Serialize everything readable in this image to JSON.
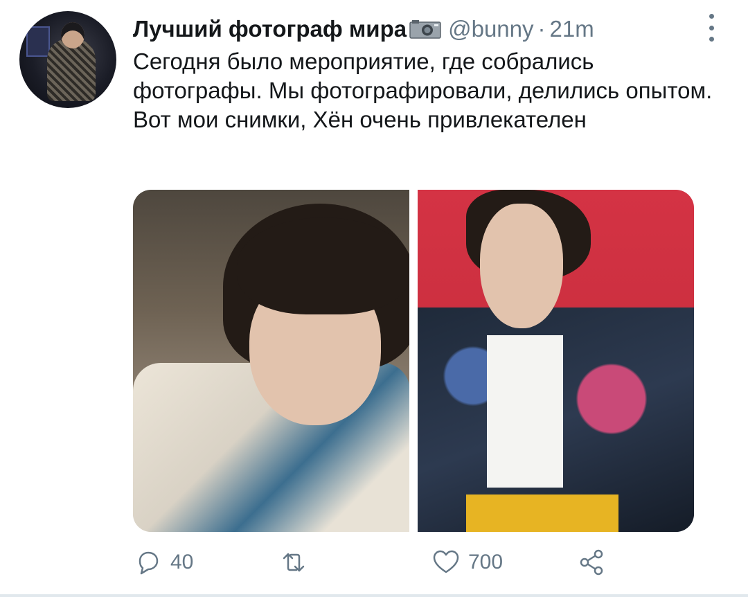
{
  "tweet": {
    "display_name": "Лучший фотограф мира",
    "handle": "@bunny",
    "separator": "·",
    "time": "21m",
    "text": "Сегодня было мероприятие, где собрались фотографы. Мы фотографировали, делились опытом. Вот мои снимки, Хён очень привлекателен"
  },
  "media": {
    "count": 2,
    "photo_1_bg": "#6e6253",
    "photo_2_bg": "#d43344"
  },
  "actions": {
    "reply_count": "40",
    "retweet_count": "",
    "like_count": "700"
  },
  "colors": {
    "text": "#14171a",
    "secondary": "#657786"
  },
  "icons": [
    "camera-icon",
    "more-icon",
    "reply-icon",
    "retweet-icon",
    "like-icon",
    "share-icon"
  ]
}
